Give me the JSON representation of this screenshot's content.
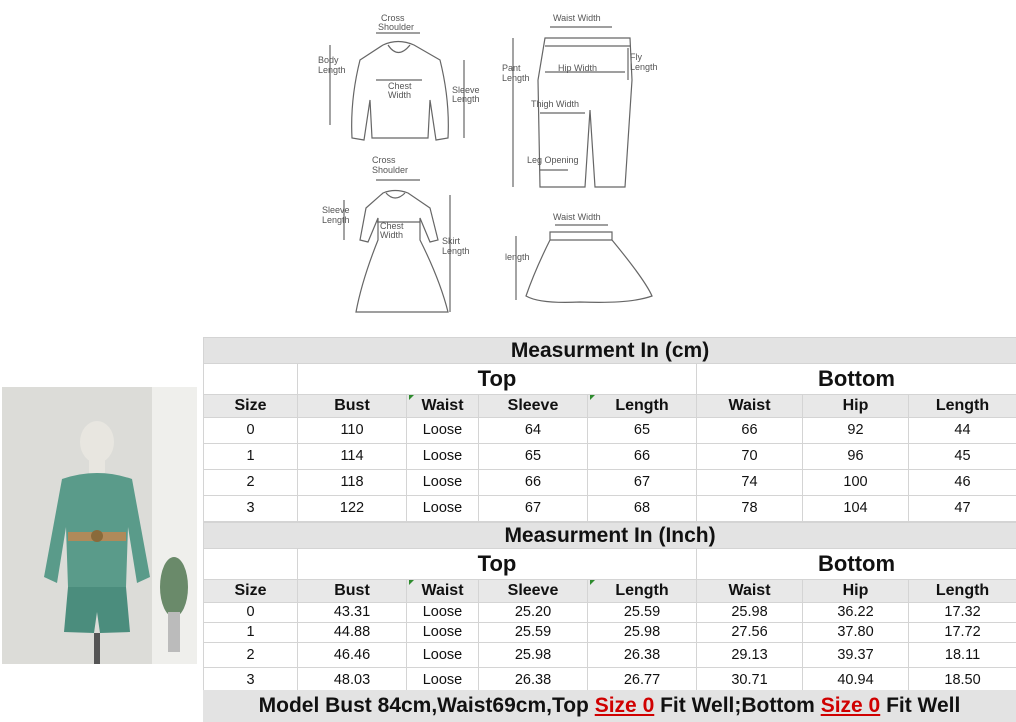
{
  "diagram": {
    "top_labels": {
      "cross_shoulder": [
        "Cross",
        "Shoulder"
      ],
      "body_length": [
        "Body",
        "Length"
      ],
      "chest_width": [
        "Chest",
        "Width"
      ],
      "sleeve_length": [
        "Sleeve",
        "Length"
      ]
    },
    "pant_labels": {
      "waist_width": "Waist Width",
      "pant_length": [
        "Pant",
        "Length"
      ],
      "hip_width": "Hip Width",
      "fly_length": [
        "Fly",
        "Length"
      ],
      "thigh_width": "Thigh Width",
      "leg_opening": "Leg Opening"
    },
    "dress_labels": {
      "cross_shoulder": [
        "Cross",
        "Shoulder"
      ],
      "sleeve_length": [
        "Sleeve",
        "Length"
      ],
      "chest_width": [
        "Chest",
        "Width"
      ],
      "skirt_length": [
        "Skirt",
        "Length"
      ]
    },
    "skirt_labels": {
      "waist_width": "Waist Width",
      "length": "length"
    }
  },
  "cm_table": {
    "title": "Measurment In (cm)",
    "group_top": "Top",
    "group_bottom": "Bottom",
    "headers": [
      "Size",
      "Bust",
      "Waist",
      "Sleeve",
      "Length",
      "Waist",
      "Hip",
      "Length"
    ],
    "rows": [
      [
        "0",
        "110",
        "Loose",
        "64",
        "65",
        "66",
        "92",
        "44"
      ],
      [
        "1",
        "114",
        "Loose",
        "65",
        "66",
        "70",
        "96",
        "45"
      ],
      [
        "2",
        "118",
        "Loose",
        "66",
        "67",
        "74",
        "100",
        "46"
      ],
      [
        "3",
        "122",
        "Loose",
        "67",
        "68",
        "78",
        "104",
        "47"
      ]
    ]
  },
  "inch_table": {
    "title": "Measurment In (Inch)",
    "group_top": "Top",
    "group_bottom": "Bottom",
    "headers": [
      "Size",
      "Bust",
      "Waist",
      "Sleeve",
      "Length",
      "Waist",
      "Hip",
      "Length"
    ],
    "rows": [
      [
        "0",
        "43.31",
        "Loose",
        "25.20",
        "25.59",
        "25.98",
        "36.22",
        "17.32"
      ],
      [
        "1",
        "44.88",
        "Loose",
        "25.59",
        "25.98",
        "27.56",
        "37.80",
        "17.72"
      ],
      [
        "2",
        "46.46",
        "Loose",
        "25.98",
        "26.38",
        "29.13",
        "39.37",
        "18.11"
      ],
      [
        "3",
        "48.03",
        "Loose",
        "26.38",
        "26.77",
        "30.71",
        "40.94",
        "18.50"
      ]
    ]
  },
  "footer": {
    "part1": "Model Bust 84cm,Waist69cm,Top ",
    "size_top": "Size 0",
    "part2": " Fit Well;Bottom ",
    "size_bottom": "Size 0",
    "part3": " Fit Well"
  },
  "colors": {
    "header_gray": "#e3e3e3",
    "highlight_red": "#d00000",
    "corner_mark_green": "#2e8b2e"
  }
}
